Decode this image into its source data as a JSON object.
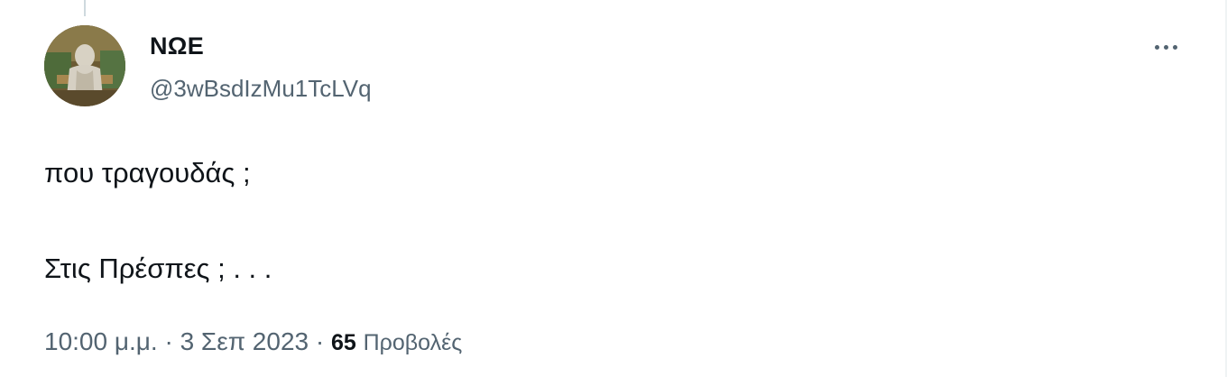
{
  "tweet": {
    "author": {
      "display_name": "ΝΩΕ",
      "handle": "@3wBsdIzMu1TcLVq"
    },
    "more_icon": "ellipsis-icon",
    "text_lines": [
      "που τραγουδάς ;",
      "Στις Πρέσπες ; . . ."
    ],
    "meta": {
      "time": "10:00 μ.μ.",
      "separator": "·",
      "date": "3 Σεπ 2023",
      "views_count": "65",
      "views_label": "Προβολές"
    }
  }
}
